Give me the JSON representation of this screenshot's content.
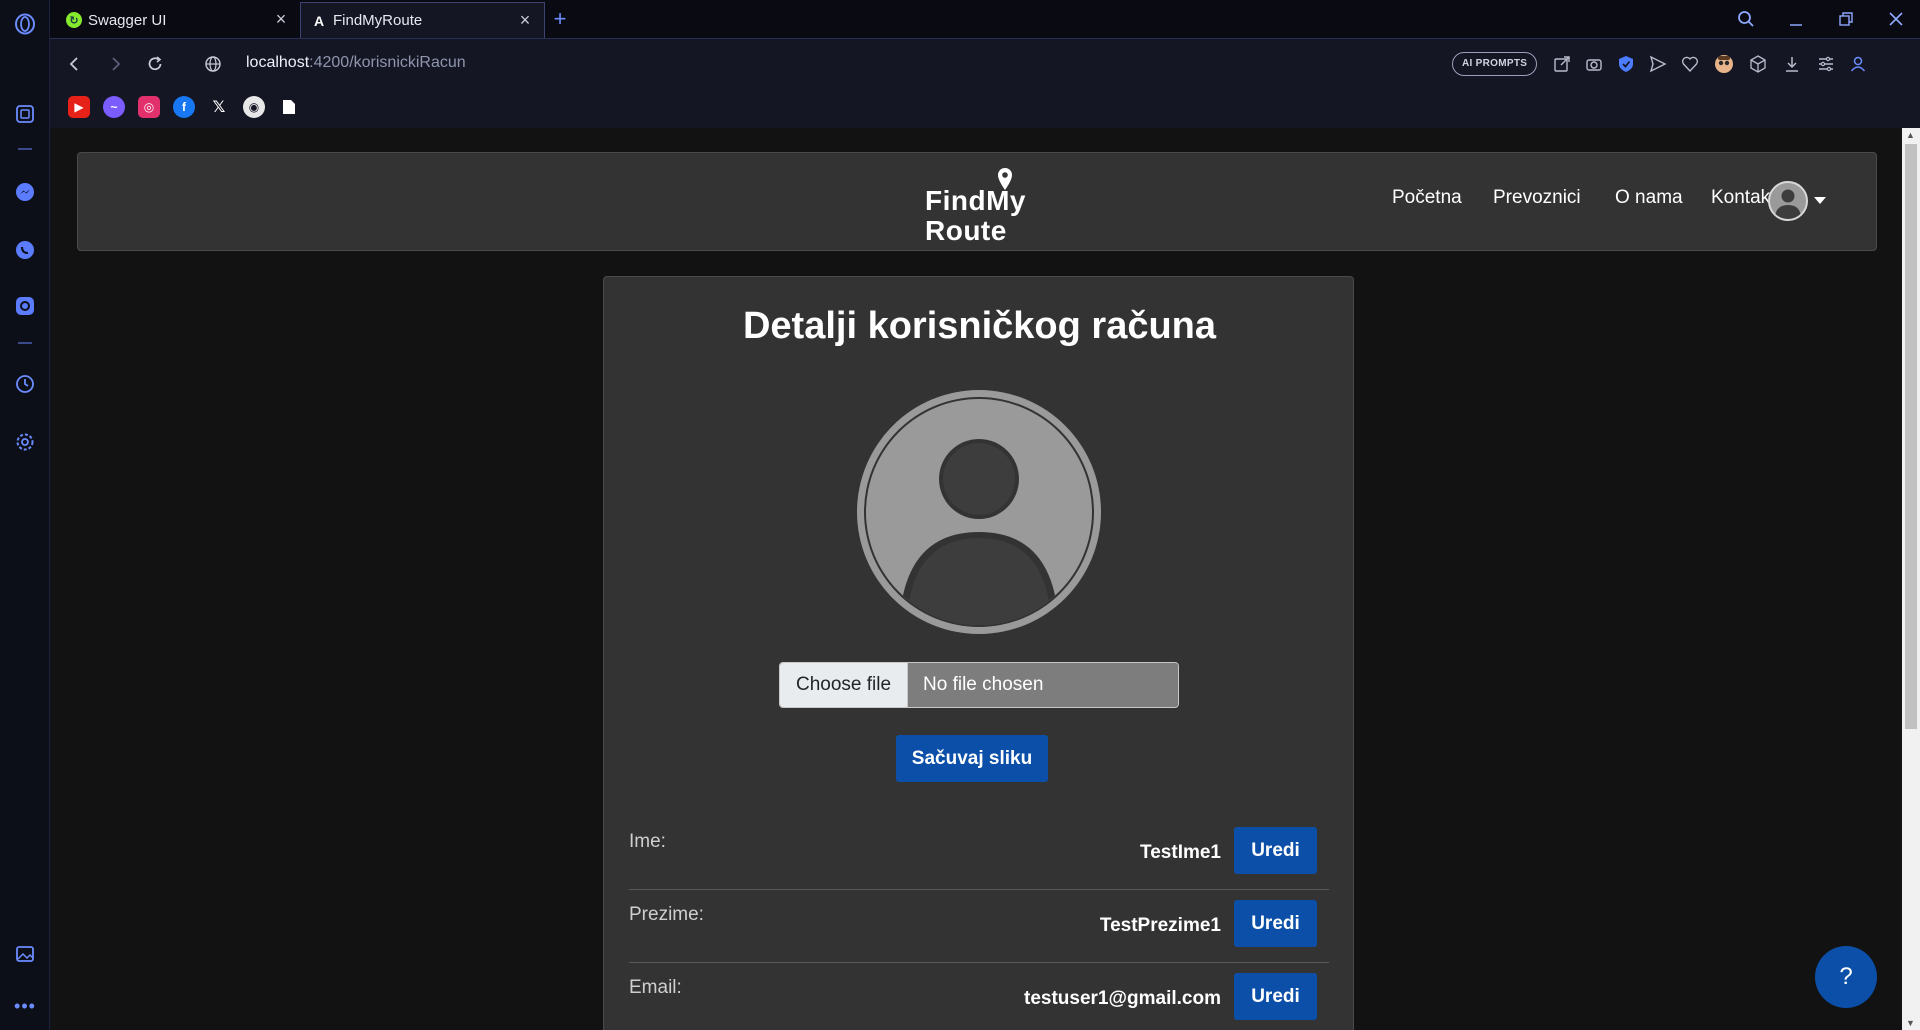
{
  "browser": {
    "tabs": [
      {
        "title": "Swagger UI"
      },
      {
        "title": "FindMyRoute"
      }
    ],
    "url_host": "localhost",
    "url_path": ":4200/korisnickiRacun",
    "ai_prompts_label": "AI PROMPTS",
    "accent_color": "#3c4370"
  },
  "site": {
    "logo_line1": "FindMy",
    "logo_line2": "Route",
    "nav": [
      "Početna",
      "Prevoznici",
      "O nama",
      "Kontakt"
    ]
  },
  "account": {
    "title": "Detalji korisničkog računa",
    "file_button": "Choose file",
    "file_status": "No file chosen",
    "save_label": "Sačuvaj sliku",
    "edit_label": "Uredi",
    "fields": [
      {
        "label": "Ime:",
        "value": "TestIme1"
      },
      {
        "label": "Prezime:",
        "value": "TestPrezime1"
      },
      {
        "label": "Email:",
        "value": "testuser1@gmail.com"
      }
    ]
  },
  "help_label": "?",
  "colors": {
    "primary_button": "#0b4fa8",
    "card_background": "#333333",
    "page_background": "#121212"
  }
}
